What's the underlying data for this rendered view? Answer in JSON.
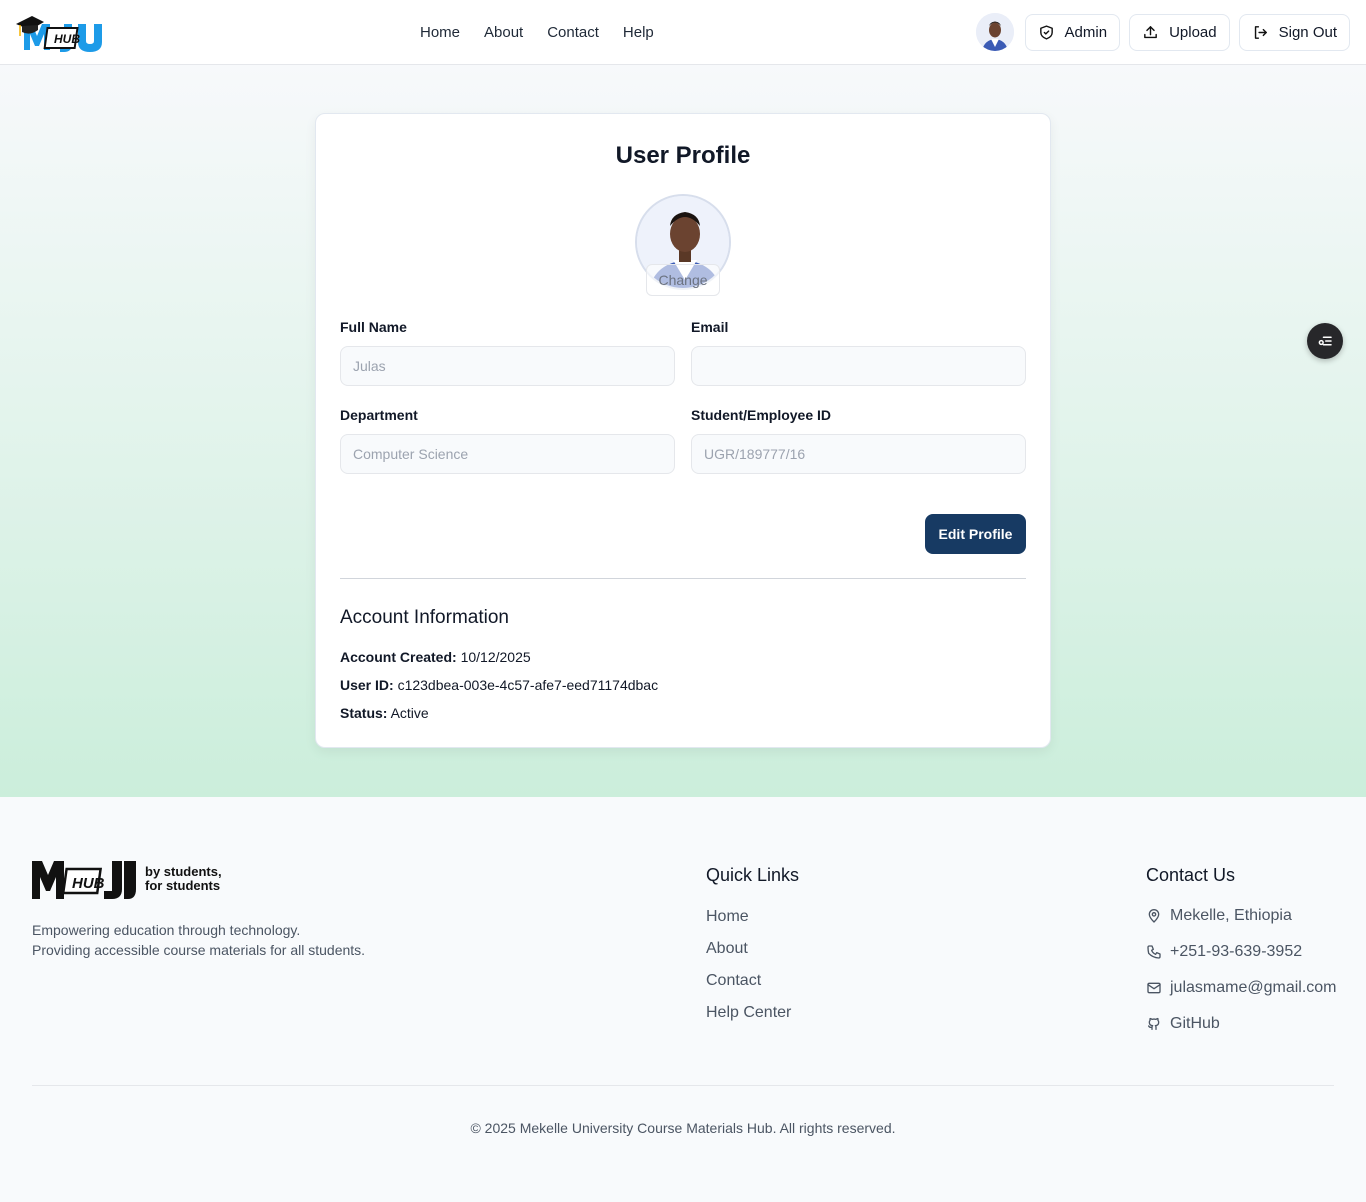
{
  "header": {
    "logo_text": "HUB",
    "nav": [
      "Home",
      "About",
      "Contact",
      "Help"
    ],
    "buttons": {
      "admin": "Admin",
      "upload": "Upload",
      "signout": "Sign Out"
    }
  },
  "profile": {
    "title": "User Profile",
    "change_label": "Change",
    "fields": {
      "full_name_label": "Full Name",
      "full_name_value": "Julas",
      "email_label": "Email",
      "email_value": "",
      "department_label": "Department",
      "department_value": "Computer Science",
      "id_label": "Student/Employee ID",
      "id_value": "UGR/189777/16"
    },
    "edit_button": "Edit Profile"
  },
  "account": {
    "title": "Account Information",
    "created_label": "Account Created:",
    "created_value": "10/12/2025",
    "user_id_label": "User ID:",
    "user_id_value": "c123dbea-003e-4c57-afe7-eed71174dbac",
    "status_label": "Status:",
    "status_value": "Active"
  },
  "footer": {
    "logo_text": "HUB",
    "logo_slogan_line1": "by students,",
    "logo_slogan_line2": "for students",
    "tagline_line1": "Empowering education through technology.",
    "tagline_line2": "Providing accessible course materials for all students.",
    "quick_links_title": "Quick Links",
    "quick_links": [
      "Home",
      "About",
      "Contact",
      "Help Center"
    ],
    "contact_title": "Contact Us",
    "contact": {
      "location": "Mekelle, Ethiopia",
      "phone": "+251-93-639-3952",
      "email": "julasmame@gmail.com",
      "github": "GitHub"
    },
    "copyright": "© 2025 Mekelle University Course Materials Hub. All rights reserved."
  },
  "colors": {
    "primary_button": "#173a63",
    "logo_blue": "#1d9be8",
    "gradient_end": "#cbeedb"
  }
}
